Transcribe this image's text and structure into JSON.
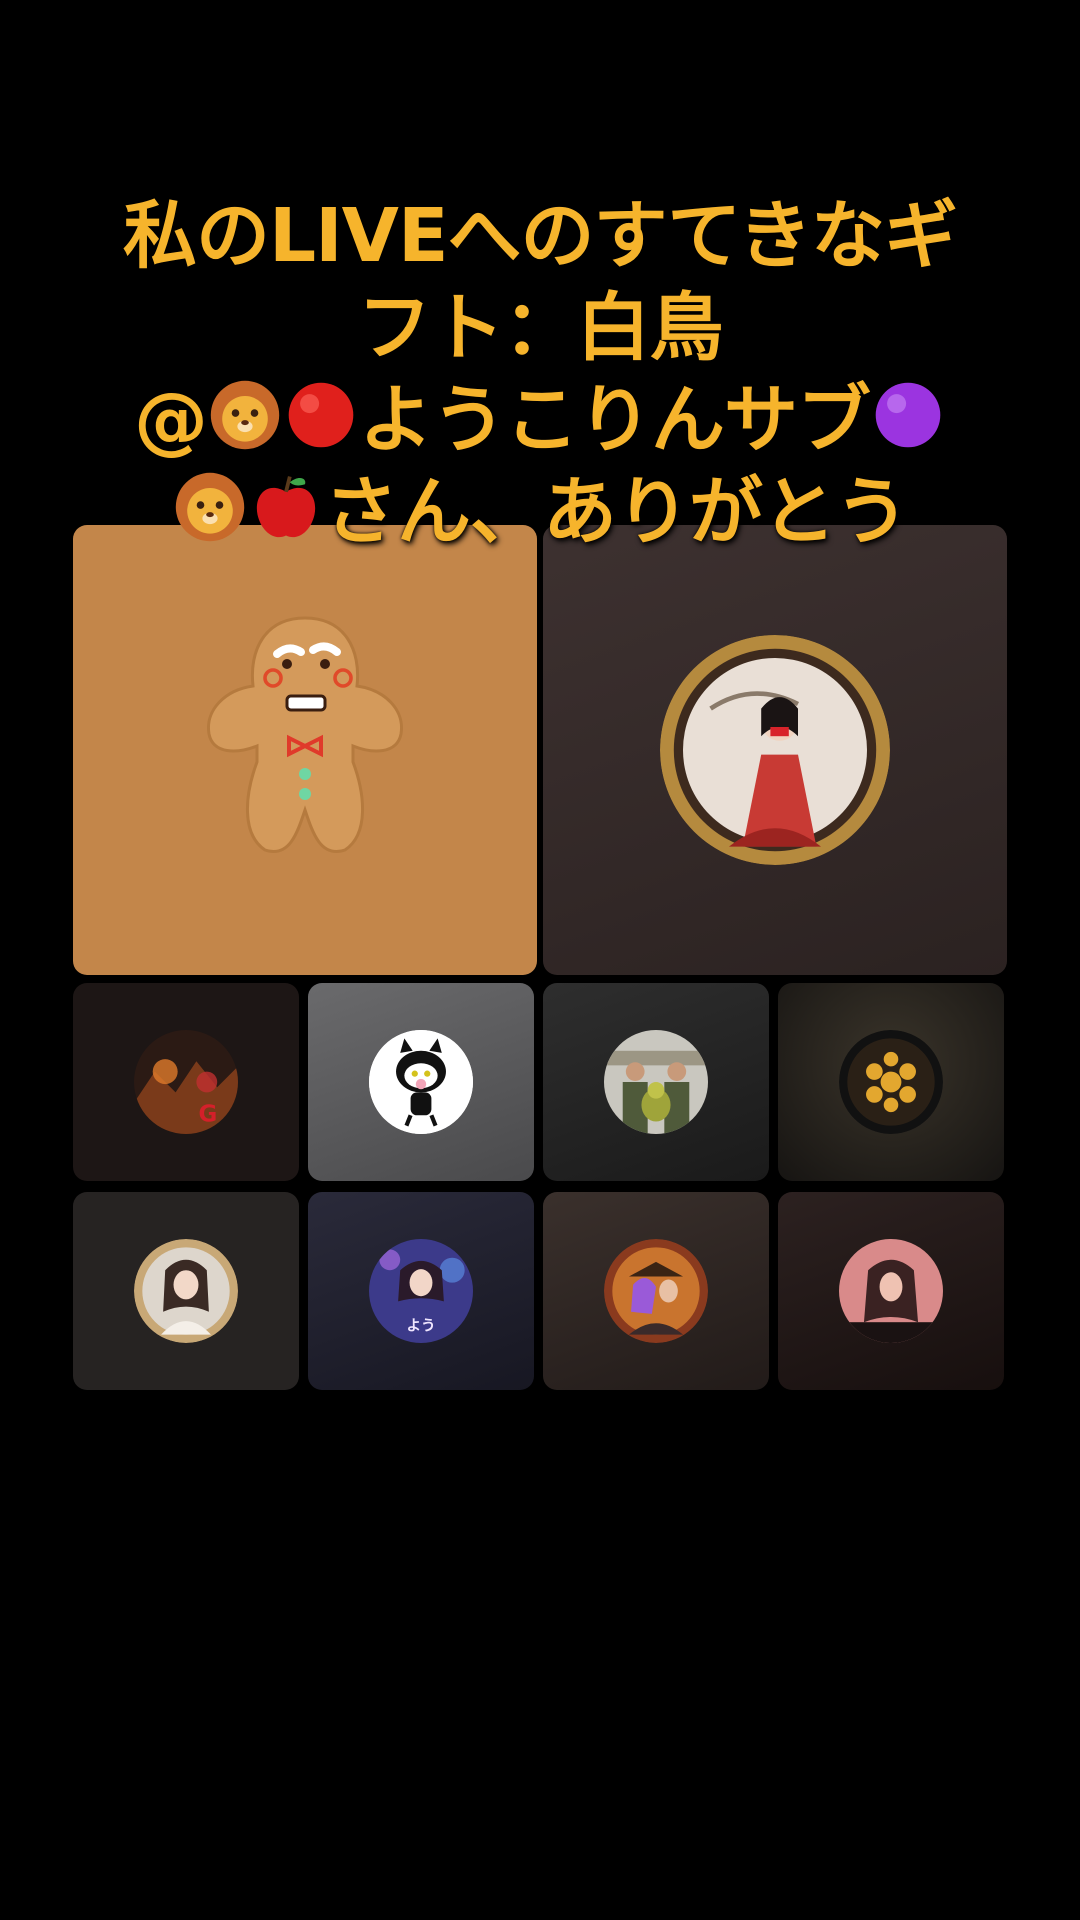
{
  "caption": {
    "line1": "私のLIVEへのすてきなギ",
    "line2": "フト：白鳥",
    "line3_prefix": "@",
    "line3_text": "ようこりんサブ",
    "line4_text": "さん、ありがとう",
    "emoji": [
      "lion-face",
      "red-circle",
      "purple-circle",
      "lion-face",
      "red-apple"
    ]
  },
  "tiles": {
    "main": [
      {
        "name": "gingerbread-avatar",
        "bg": "#c3864a"
      },
      {
        "name": "kimono-woman-avatar",
        "bg": "#352a29"
      }
    ],
    "row1": [
      {
        "name": "warrior-collage-avatar",
        "bg": "#1d1615"
      },
      {
        "name": "cartoon-cat-avatar",
        "bg": "#5a5a5c"
      },
      {
        "name": "group-photo-avatar",
        "bg": "#222"
      },
      {
        "name": "gold-emblem-avatar",
        "bg": "#1b1916"
      }
    ],
    "row2": [
      {
        "name": "bride-portrait-avatar",
        "bg": "#262322"
      },
      {
        "name": "purple-girl-avatar",
        "bg": "#1d1c27"
      },
      {
        "name": "couple-portrait-avatar",
        "bg": "#2d2422"
      },
      {
        "name": "pink-woman-avatar",
        "bg": "#201716"
      }
    ]
  }
}
